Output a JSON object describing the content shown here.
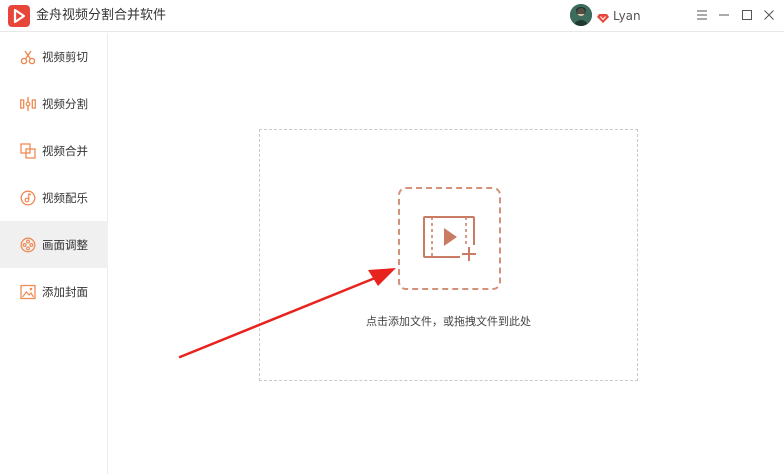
{
  "app": {
    "title": "金舟视频分割合并软件",
    "accent_color": "#e8463a",
    "icon": "play-logo-icon"
  },
  "user": {
    "name": "Lyan",
    "avatar_icon": "user-avatar",
    "badge_icon": "vip-diamond-icon"
  },
  "window_controls": [
    "menu-icon",
    "minimize-icon",
    "maximize-icon",
    "close-icon"
  ],
  "sidebar": {
    "items": [
      {
        "label": "视频剪切",
        "icon": "scissors-icon",
        "active": false
      },
      {
        "label": "视频分割",
        "icon": "split-icon",
        "active": false
      },
      {
        "label": "视频合并",
        "icon": "merge-icon",
        "active": false
      },
      {
        "label": "视频配乐",
        "icon": "music-disc-icon",
        "active": false
      },
      {
        "label": "画面调整",
        "icon": "film-reel-icon",
        "active": true
      },
      {
        "label": "添加封面",
        "icon": "image-icon",
        "active": false
      }
    ]
  },
  "main": {
    "dropzone_hint": "点击添加文件，或拖拽文件到此处",
    "add_icon": "add-video-icon",
    "annotation": "red-arrow-icon"
  }
}
